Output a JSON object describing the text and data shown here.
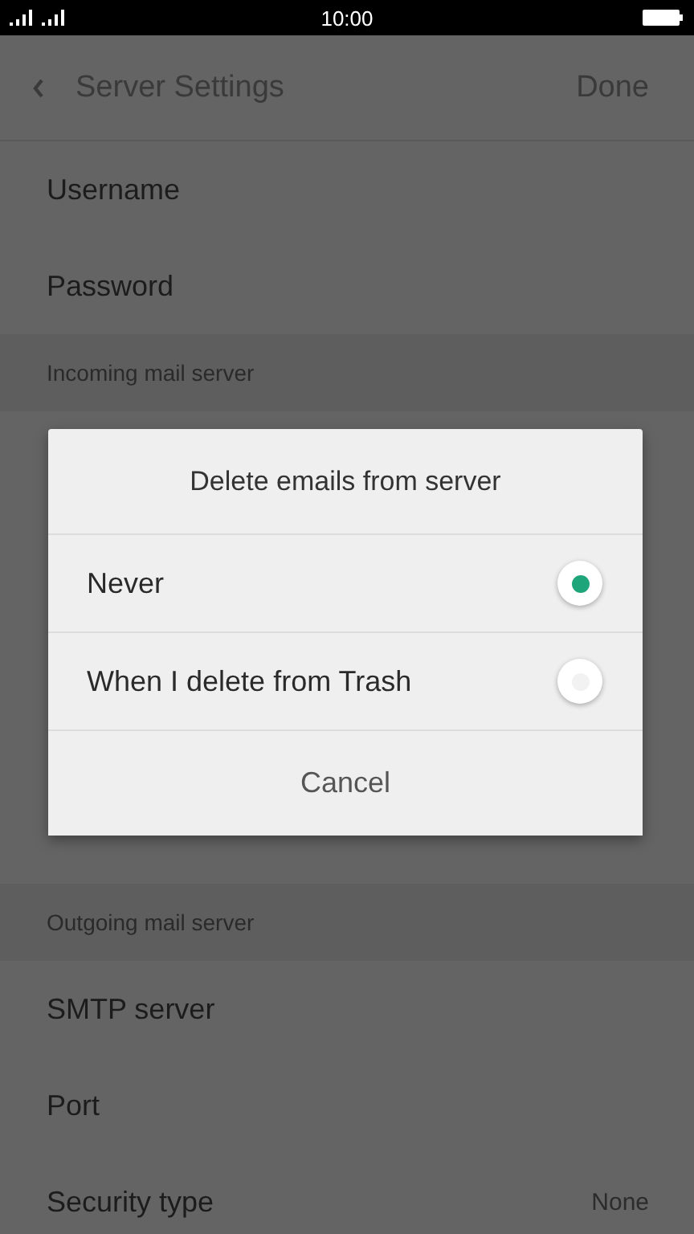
{
  "status_bar": {
    "time": "10:00"
  },
  "header": {
    "title": "Server Settings",
    "action": "Done"
  },
  "rows": [
    {
      "kind": "item",
      "label": "Username"
    },
    {
      "kind": "item",
      "label": "Password"
    },
    {
      "kind": "section",
      "label": "Incoming mail server"
    },
    {
      "kind": "hidden"
    },
    {
      "kind": "section",
      "label": "Outgoing mail server"
    },
    {
      "kind": "item",
      "label": "SMTP server"
    },
    {
      "kind": "item",
      "label": "Port"
    },
    {
      "kind": "item",
      "label": "Security type",
      "value": "None"
    }
  ],
  "dialog": {
    "title": "Delete emails from server",
    "options": [
      {
        "label": "Never",
        "selected": true
      },
      {
        "label": "When I delete from Trash",
        "selected": false
      }
    ],
    "cancel": "Cancel"
  }
}
